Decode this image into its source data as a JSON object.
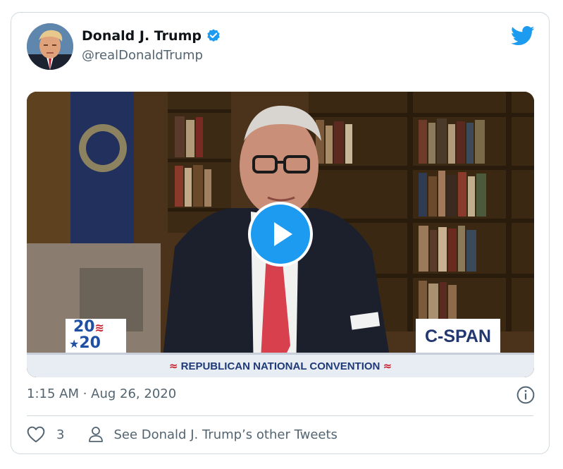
{
  "tweet": {
    "author_name": "Donald J. Trump",
    "handle": "@realDonaldTrump",
    "timestamp": "1:15 AM · Aug 26, 2020",
    "like_count": "3",
    "other_tweets_label": "See Donald J. Trump’s other Tweets"
  },
  "video": {
    "logo_2020_top": "20",
    "logo_2020_bottom": "20",
    "network_logo": "C-SPAN",
    "lower_third": "REPUBLICAN NATIONAL CONVENTION"
  },
  "colors": {
    "brand_blue": "#1d9bf0",
    "secondary_text": "#536471",
    "border": "#cfd9de"
  },
  "icons": [
    "verified-badge-icon",
    "twitter-bird-icon",
    "play-icon",
    "info-icon",
    "heart-icon",
    "person-icon"
  ]
}
